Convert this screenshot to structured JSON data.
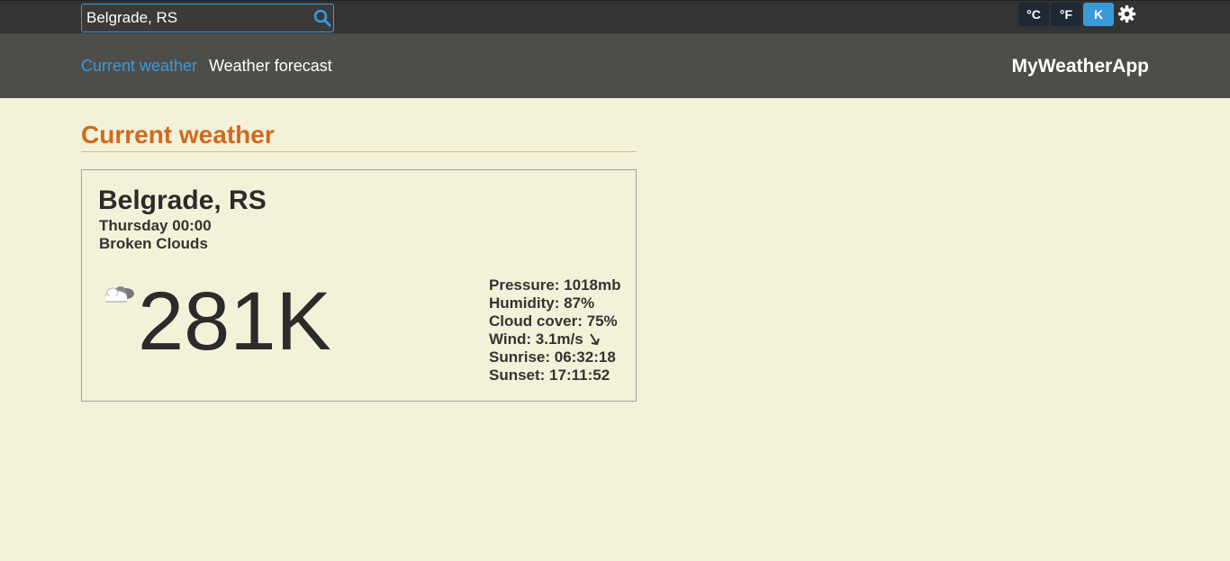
{
  "search": {
    "value": "Belgrade, RS",
    "icon": "search-icon"
  },
  "units": [
    {
      "label": "°C",
      "active": false
    },
    {
      "label": "°F",
      "active": false
    },
    {
      "label": "K",
      "active": true
    }
  ],
  "settings_icon": "gear-icon",
  "nav": {
    "current_label": "Current weather",
    "forecast_label": "Weather forecast",
    "brand": "MyWeatherApp"
  },
  "main": {
    "section_title": "Current weather",
    "card": {
      "city": "Belgrade, RS",
      "datetime": "Thursday 00:00",
      "condition": "Broken Clouds",
      "icon": "broken-clouds-icon",
      "temperature": "281K",
      "details": {
        "pressure": "Pressure: 1018mb",
        "humidity": "Humidity: 87%",
        "cloud_cover": "Cloud cover: 75%",
        "wind": "Wind: 3.1m/s",
        "wind_icon": "wind-direction-arrow-icon",
        "sunrise": "Sunrise: 06:32:18",
        "sunset": "Sunset: 17:11:52"
      }
    }
  },
  "colors": {
    "background": "#f3f2d9",
    "accent": "#3a9ad9",
    "title": "#d2691e",
    "topbar": "#333333",
    "navbar": "#4e4d4a"
  }
}
